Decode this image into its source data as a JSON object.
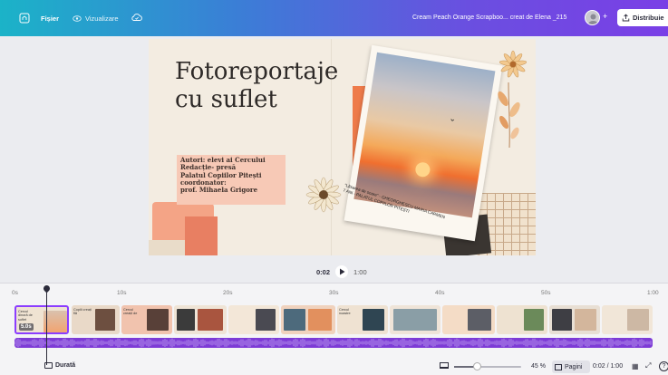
{
  "topbar": {
    "file_label": "Fișier",
    "view_label": "Vizualizare",
    "doc_title": "Cream Peach Orange Scrapboo... creat de Elena _215",
    "plus": "+",
    "share_label": "Distribuie"
  },
  "slide": {
    "title": "Fotoreportaje\ncu suflet",
    "credits": "Autori: elevi ai Cercului\nRedacție- presă\nPalatul Copiilor Pitești\ncoordonator:\nprof. Mihaela Grigore",
    "photo_caption": "“Lăsarea de soare” - GHEORGHESCU MARIA CARMEN\n7 ANI - PALATUL COPIILOR PITEȘTI"
  },
  "playback": {
    "current": "0:02",
    "total": "1:00"
  },
  "timeline": {
    "ticks": [
      "0s",
      "10s",
      "20s",
      "30s",
      "40s",
      "50s",
      "1:00"
    ],
    "selected_clip_duration": "5.0s",
    "clip_labels": [
      "Cercul dinoră\nde suflet",
      "Copiii\ncreați flă",
      "Cercul\ncreații de",
      "",
      "Cercul\nnoastre",
      ""
    ]
  },
  "footer": {
    "duration_label": "Durată",
    "zoom_value": "45 %",
    "pages_label": "Pagini",
    "time_readout": "0:02 / 1:00",
    "help": "?"
  },
  "colors": {
    "accent": "#8b3dff",
    "audio_track": "#7d3bd6",
    "title_ink": "#2e2a28",
    "credits_box": "#f7c9b6"
  },
  "zoom_level": 0.45
}
